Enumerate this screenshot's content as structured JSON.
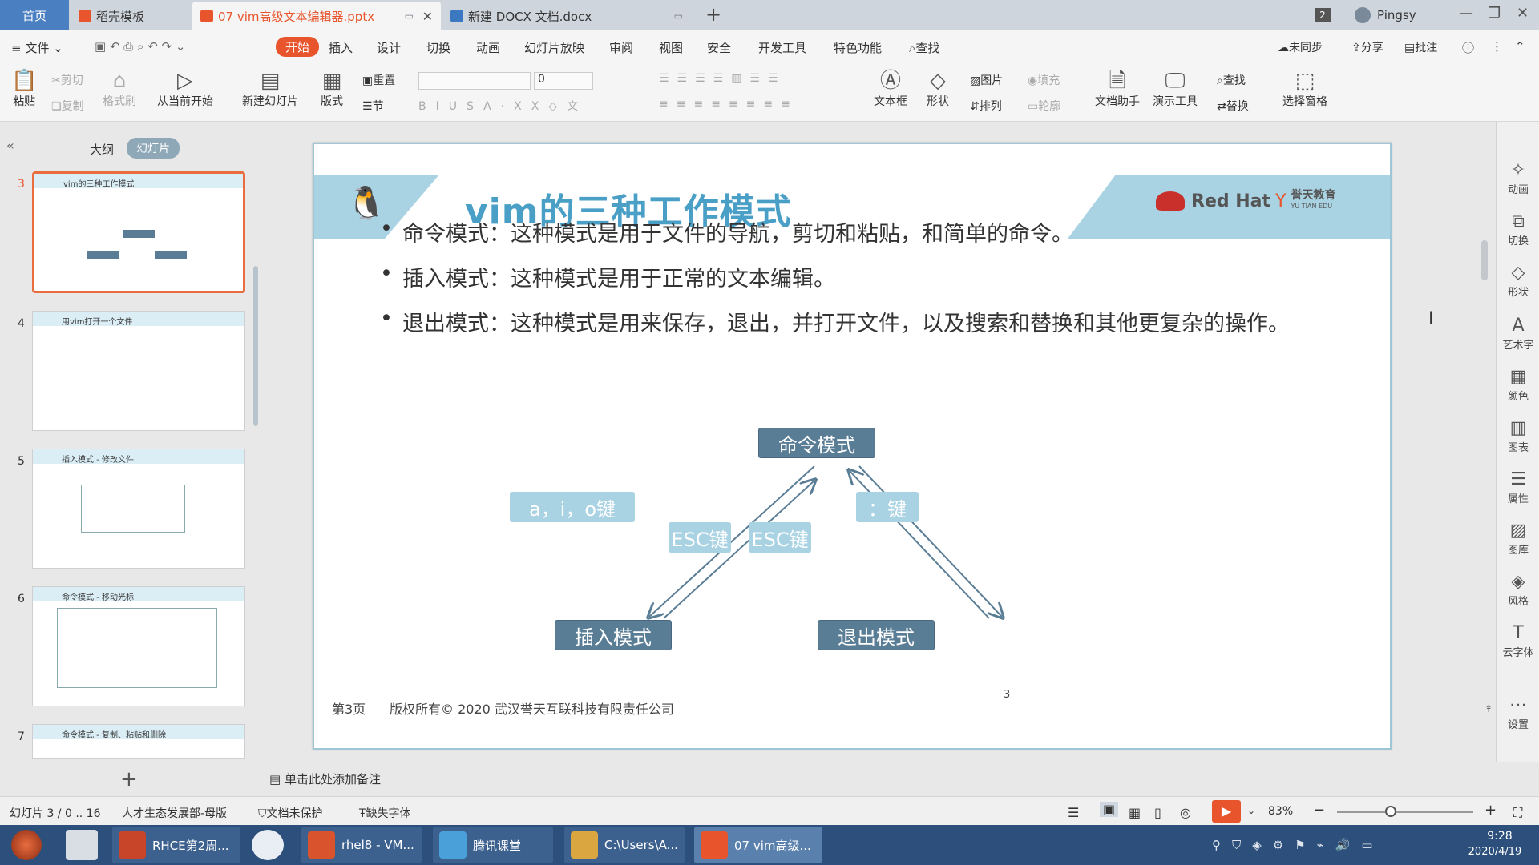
{
  "tabs": {
    "home": "首页",
    "items": [
      {
        "label": "稻壳模板"
      },
      {
        "label": "07 vim高级文本编辑器.pptx"
      },
      {
        "label": "新建 DOCX 文档.docx"
      }
    ],
    "add": "+",
    "badge": "2",
    "user": "Pingsy"
  },
  "menu": {
    "file": "文件",
    "items": [
      "开始",
      "插入",
      "设计",
      "切换",
      "动画",
      "幻灯片放映",
      "审阅",
      "视图",
      "安全",
      "开发工具",
      "特色功能"
    ],
    "search": "查找",
    "sync": "未同步",
    "share": "分享",
    "comment": "批注"
  },
  "ribbon": {
    "paste": "粘贴",
    "cut": "剪切",
    "copy": "复制",
    "format_painter": "格式刷",
    "from_current": "从当前开始",
    "new_slide": "新建幻灯片",
    "layout": "版式",
    "reset": "重置",
    "section": "节",
    "font_size": "0",
    "textbox": "文本框",
    "shape": "形状",
    "picture": "图片",
    "fill": "填充",
    "arrange": "排列",
    "outline": "轮廓",
    "doc_helper": "文档助手",
    "present_tools": "演示工具",
    "find": "查找",
    "replace": "替换",
    "select_pane": "选择窗格"
  },
  "panel": {
    "outline_tab": "大纲",
    "slides_tab": "幻灯片",
    "thumbs": [
      {
        "num": "3",
        "title": "vim的三种工作模式"
      },
      {
        "num": "4",
        "title": "用vim打开一个文件"
      },
      {
        "num": "5",
        "title": "插入模式 - 修改文件"
      },
      {
        "num": "6",
        "title": "命令模式 - 移动光标"
      },
      {
        "num": "7",
        "title": "命令模式 - 复制、粘贴和删除"
      }
    ],
    "add": "+"
  },
  "slide": {
    "title": "vim的三种工作模式",
    "brand": "Red Hat",
    "brand2": "誉天教育",
    "brand3": "YU TIAN EDU",
    "bullets": [
      "命令模式：这种模式是用于文件的导航，剪切和粘贴，和简单的命令。",
      "插入模式：这种模式是用于正常的文本编辑。",
      "退出模式：这种模式是用来保存，退出，并打开文件，以及搜索和替换和其他更复杂的操作。"
    ],
    "diagram": {
      "top": "命令模式",
      "left": "插入模式",
      "right": "退出模式",
      "aio": "a，i，o键",
      "esc1": "ESC键",
      "esc2": "ESC键",
      "colon": "：键"
    },
    "page": "第3页",
    "copyright": "版权所有© 2020 武汉誉天互联科技有限责任公司",
    "page_num": "3"
  },
  "notes": "单击此处添加备注",
  "rightbar": [
    "动画",
    "切换",
    "形状",
    "艺术字",
    "颜色",
    "图表",
    "属性",
    "图库",
    "风格",
    "云字体",
    "设置"
  ],
  "status": {
    "slide": "幻灯片 3 / 0 .. 16",
    "template": "人才生态发展部-母版",
    "protect": "文档未保护",
    "font": "缺失字体",
    "zoom": "83%"
  },
  "taskbar": {
    "items": [
      "RHCE第2周...",
      "rhel8 - VM...",
      "腾讯课堂",
      "C:\\Users\\A...",
      "07 vim高级..."
    ],
    "time": "9:28",
    "date": "2020/4/19"
  },
  "colors": {
    "accent": "#e8552c",
    "slide_blue": "#4a9fc6",
    "box_dark": "#5a7d96",
    "box_light": "#a9d2e3",
    "taskbar": "#2c4f7c"
  }
}
